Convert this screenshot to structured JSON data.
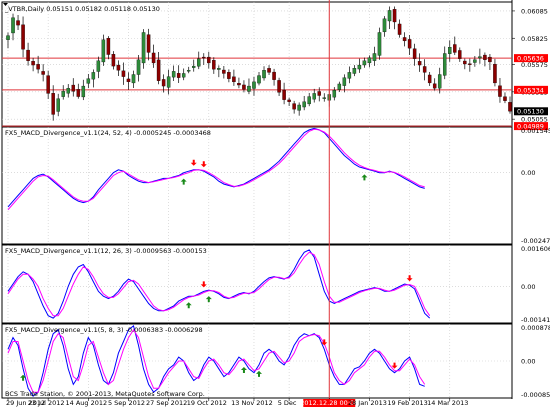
{
  "colors": {
    "background": "#ffffff",
    "grid": "#c8c8c8",
    "separator": "#000000",
    "bull_candle": "#2e8b3a",
    "bear_candle": "#8b0000",
    "wick": "#000000",
    "hline": "#e0343a",
    "vline": "#e0343a",
    "macd": "#0000ff",
    "signal": "#ff00ff",
    "up_arrow": "#1a8a1a",
    "down_arrow": "#ff0000",
    "price_pill": "#ff0000",
    "current_pill": "#000000"
  },
  "chart_data": [
    {
      "type": "candlestick",
      "title": "_VTBR,Daily  0.05151 0.05182 0.05118 0.05130",
      "y_axis_ticks": [
        "0.06085",
        "0.05825",
        "0.05575",
        "0.05315",
        "0.05055"
      ],
      "ylim": [
        0.0499,
        0.0617
      ],
      "price_levels": [
        {
          "label": "0.05636",
          "value": 0.05636
        },
        {
          "label": "0.05334",
          "value": 0.05334
        },
        {
          "label": "0.04989",
          "value": 0.04989
        }
      ],
      "current_price": {
        "label": "0.05130",
        "value": 0.0513
      },
      "close_series": [
        0.0585,
        0.0602,
        0.0595,
        0.0572,
        0.0561,
        0.0557,
        0.0553,
        0.0548,
        0.053,
        0.051,
        0.0525,
        0.0532,
        0.0535,
        0.0532,
        0.0527,
        0.0537,
        0.0544,
        0.055,
        0.0561,
        0.0581,
        0.0567,
        0.0556,
        0.0552,
        0.0546,
        0.0541,
        0.0548,
        0.0562,
        0.0588,
        0.0569,
        0.0559,
        0.0542,
        0.0537,
        0.0546,
        0.0551,
        0.0545,
        0.0549,
        0.0552,
        0.0556,
        0.0563,
        0.0564,
        0.0559,
        0.0553,
        0.0554,
        0.0549,
        0.0544,
        0.0541,
        0.0538,
        0.0534,
        0.0537,
        0.0541,
        0.0547,
        0.0552,
        0.055,
        0.0543,
        0.0531,
        0.0524,
        0.0522,
        0.0515,
        0.0519,
        0.0522,
        0.0527,
        0.053,
        0.0528,
        0.0526,
        0.0529,
        0.0533,
        0.0539,
        0.0545,
        0.055,
        0.0554,
        0.0557,
        0.0561,
        0.0564,
        0.0568,
        0.0588,
        0.0601,
        0.0609,
        0.0598,
        0.0586,
        0.058,
        0.0573,
        0.0563,
        0.0557,
        0.055,
        0.054,
        0.0535,
        0.0548,
        0.0568,
        0.0574,
        0.0569,
        0.0563,
        0.0558,
        0.0558,
        0.0562,
        0.0565,
        0.0562,
        0.056,
        0.054,
        0.0527,
        0.0523,
        0.0513
      ],
      "x_tick_labels": [
        "29 Jun 2012",
        "23 Jul 2012",
        "14 Aug 2012",
        "5 Sep 2012",
        "27 Sep 2012",
        "19 Oct 2012",
        "13 Nov 2012",
        "5 Dec",
        "2012.12.28 00:00",
        "28 Jan 2013",
        "19 Feb 2013",
        "14 Mar 2013"
      ],
      "x_tick_index": [
        0,
        8,
        16,
        24,
        32,
        40,
        49,
        56,
        64,
        72,
        80,
        88
      ],
      "cursor_index": 64,
      "cursor_label": "2012.12.28 00:00"
    },
    {
      "type": "line",
      "title": "FX5_MACD_Divergence_v1.1(24, 52, 4) -0.0005245 -0.0003468",
      "series": [
        {
          "name": "MACD",
          "values": [
            -0.0012,
            -0.001,
            -0.0008,
            -0.0006,
            -0.0004,
            -0.0002,
            -0.0001,
            -5e-05,
            -0.00015,
            -0.0003,
            -0.00045,
            -0.0006,
            -0.00075,
            -0.0009,
            -0.001,
            -0.00105,
            -0.001,
            -0.00085,
            -0.0006,
            -0.0004,
            -0.0002,
            0.0,
            0.0001,
            5e-05,
            -0.0001,
            -0.0002,
            -0.0003,
            -0.00035,
            -0.00035,
            -0.0003,
            -0.00025,
            -0.0002,
            -0.0002,
            -0.00015,
            -0.0001,
            0.0,
            5e-05,
            0.0001,
            0.0001,
            5e-05,
            -5e-05,
            -0.00015,
            -0.0003,
            -0.0004,
            -0.00045,
            -0.0005,
            -0.00045,
            -0.0004,
            -0.0003,
            -0.0002,
            -0.0001,
            0.0,
            0.0001,
            0.00025,
            0.0004,
            0.0006,
            0.0008,
            0.001,
            0.0012,
            0.0014,
            0.0015,
            0.00155,
            0.0015,
            0.0014,
            0.0012,
            0.001,
            0.0008,
            0.0006,
            0.00045,
            0.0003,
            0.0002,
            0.00015,
            0.0001,
            5e-05,
            0.0,
            0.0,
            5e-05,
            0.0,
            -0.0001,
            -0.0002,
            -0.0003,
            -0.0004,
            -0.0005,
            -0.00055
          ]
        },
        {
          "name": "Signal",
          "values": [
            -0.0013,
            -0.0011,
            -0.0009,
            -0.0007,
            -0.0005,
            -0.0003,
            -0.00015,
            -0.0001,
            -0.00012,
            -0.00025,
            -0.0004,
            -0.00055,
            -0.0007,
            -0.00085,
            -0.00095,
            -0.001,
            -0.001,
            -0.0009,
            -0.0007,
            -0.0005,
            -0.0003,
            -0.0001,
            0.0,
            5e-05,
            -5e-05,
            -0.00015,
            -0.00025,
            -0.0003,
            -0.00035,
            -0.00032,
            -0.00028,
            -0.00024,
            -0.0002,
            -0.00017,
            -0.00012,
            -5e-05,
            0.0,
            8e-05,
            0.0001,
            8e-05,
            0.0,
            -0.0001,
            -0.00022,
            -0.00035,
            -0.00042,
            -0.00048,
            -0.00047,
            -0.00042,
            -0.00035,
            -0.00025,
            -0.00015,
            -5e-05,
            5e-05,
            0.00018,
            0.00032,
            0.0005,
            0.0007,
            0.0009,
            0.0011,
            0.0013,
            0.00145,
            0.00152,
            0.0015,
            0.00142,
            0.00128,
            0.0011,
            0.0009,
            0.0007,
            0.00053,
            0.00038,
            0.00026,
            0.00018,
            0.00012,
            8e-05,
            3e-05,
            1e-05,
            3e-05,
            1e-05,
            -6e-05,
            -0.00015,
            -0.00025,
            -0.00035,
            -0.00045,
            -0.0005
          ]
        }
      ],
      "y_axis_ticks": [
        "0.001545",
        "0.00",
        "-0.002477"
      ],
      "ylim": [
        -0.0025,
        0.0016
      ],
      "arrows": [
        {
          "kind": "up",
          "index": 35
        },
        {
          "kind": "down",
          "index": 37
        },
        {
          "kind": "down",
          "index": 39
        },
        {
          "kind": "up",
          "index": 71
        }
      ]
    },
    {
      "type": "line",
      "title": "FX5_MACD_Divergence_v1.1(12, 26, 3) -0.0009563 -0.000153",
      "series": [
        {
          "name": "MACD",
          "values": [
            -0.0002,
            0.0001,
            0.0004,
            0.0006,
            0.0005,
            0.0002,
            -0.0003,
            -0.0008,
            -0.0012,
            -0.0013,
            -0.0011,
            -0.0006,
            0.0,
            0.0005,
            0.0008,
            0.0009,
            0.0006,
            0.0002,
            -0.0002,
            -0.0004,
            -0.0005,
            -0.0004,
            -0.0002,
            0.0001,
            0.0003,
            0.0002,
            -0.0001,
            -0.0004,
            -0.0007,
            -0.0009,
            -0.001,
            -0.001,
            -0.0009,
            -0.0008,
            -0.0006,
            -0.0005,
            -0.0004,
            -0.0004,
            -0.0003,
            -0.0002,
            -0.00015,
            -0.0002,
            -0.0003,
            -0.00045,
            -0.0005,
            -0.0004,
            -0.0003,
            -0.00025,
            -0.0003,
            -0.0002,
            0.0,
            0.0002,
            0.00035,
            0.0004,
            0.00035,
            0.0003,
            0.0004,
            0.0007,
            0.0011,
            0.0014,
            0.0015,
            0.0012,
            0.0005,
            -0.0002,
            -0.0006,
            -0.0007,
            -0.0006,
            -0.0005,
            -0.0004,
            -0.0003,
            -0.0002,
            -0.00015,
            -0.0001,
            -5e-05,
            -0.0001,
            -0.0002,
            -0.0002,
            -0.0001,
            0.0,
            0.0001,
            5e-05,
            -0.0001,
            -0.0006,
            -0.0011,
            -0.0013
          ]
        },
        {
          "name": "Signal",
          "values": [
            -0.0003,
            0.0,
            0.0003,
            0.0005,
            0.0005,
            0.0003,
            0.0,
            -0.0005,
            -0.0009,
            -0.0012,
            -0.0012,
            -0.0009,
            -0.0004,
            0.0001,
            0.0005,
            0.0008,
            0.0007,
            0.0004,
            0.0,
            -0.0003,
            -0.00045,
            -0.00045,
            -0.0003,
            -5e-05,
            0.0002,
            0.00025,
            0.0001,
            -0.0002,
            -0.0005,
            -0.0008,
            -0.00095,
            -0.001,
            -0.00095,
            -0.00085,
            -0.0007,
            -0.00055,
            -0.00045,
            -0.0004,
            -0.00035,
            -0.00025,
            -0.00018,
            -0.00018,
            -0.00025,
            -0.0004,
            -0.00048,
            -0.00045,
            -0.00035,
            -0.00028,
            -0.00028,
            -0.00025,
            -0.0001,
            0.0001,
            0.00028,
            0.00038,
            0.00038,
            0.00032,
            0.00035,
            0.00055,
            0.0009,
            0.0012,
            0.0014,
            0.0013,
            0.0009,
            0.0002,
            -0.0004,
            -0.00065,
            -0.00065,
            -0.00055,
            -0.00045,
            -0.00035,
            -0.00025,
            -0.00018,
            -0.00012,
            -8e-05,
            -8e-05,
            -0.00015,
            -0.0002,
            -0.00015,
            -5e-05,
            5e-05,
            8e-05,
            0.0,
            -0.0004,
            -0.0009,
            -0.0012
          ]
        }
      ],
      "y_axis_ticks": [
        "0.001606",
        "0.00",
        "-0.001412"
      ],
      "ylim": [
        -0.0015,
        0.0017
      ],
      "arrows": [
        {
          "kind": "up",
          "index": 36
        },
        {
          "kind": "down",
          "index": 39
        },
        {
          "kind": "up",
          "index": 40
        },
        {
          "kind": "down",
          "index": 80
        }
      ]
    },
    {
      "type": "line",
      "title": "FX5_MACD_Divergence_v1.1(5, 8, 3) -0.0006383 -0.0006298",
      "series": [
        {
          "name": "MACD",
          "values": [
            0.0003,
            0.0006,
            0.0004,
            -0.0002,
            -0.0007,
            -0.0009,
            -0.0008,
            -0.0003,
            0.0003,
            0.0007,
            0.0008,
            0.0004,
            -0.0002,
            -0.0006,
            -0.0004,
            0.0002,
            0.0006,
            0.0004,
            -0.0001,
            -0.0005,
            -0.0006,
            -0.0003,
            0.0002,
            0.0005,
            0.0008,
            0.0009,
            0.0004,
            -0.0002,
            -0.0006,
            -0.0008,
            -0.0007,
            -0.0004,
            -0.0002,
            -0.0001,
            0.0001,
            0.0,
            -0.0003,
            -0.0005,
            -0.0004,
            -0.0001,
            0.0001,
            0.0,
            -0.0002,
            -0.0004,
            -0.0003,
            -0.0001,
            0.0001,
            0.0,
            -0.0002,
            -0.0003,
            -0.0001,
            0.0002,
            0.0003,
            0.0002,
            0.0,
            -0.0001,
            0.0001,
            0.0004,
            0.0006,
            0.0007,
            0.00065,
            0.0007,
            0.0006,
            0.0003,
            -0.0001,
            -0.0004,
            -0.0006,
            -0.0006,
            -0.0004,
            -0.0002,
            -0.00015,
            0.0,
            0.0002,
            0.0003,
            0.0002,
            0.0,
            -0.0002,
            -0.0003,
            -0.0002,
            0.0,
            0.0001,
            -0.0002,
            -0.0006,
            -0.00065
          ]
        },
        {
          "name": "Signal",
          "values": [
            0.0002,
            0.0005,
            0.0005,
            0.0,
            -0.0005,
            -0.0008,
            -0.0008,
            -0.0005,
            0.0,
            0.0005,
            0.0007,
            0.0006,
            0.0001,
            -0.0004,
            -0.0005,
            -0.0001,
            0.0004,
            0.0005,
            0.0001,
            -0.0003,
            -0.0006,
            -0.0005,
            -0.0001,
            0.0003,
            0.0006,
            0.0008,
            0.0006,
            0.0001,
            -0.0004,
            -0.0007,
            -0.0007,
            -0.0005,
            -0.0003,
            -0.00015,
            0.0,
            0.0,
            -0.0002,
            -0.0004,
            -0.00045,
            -0.0002,
            0.0,
            5e-05,
            -0.0001,
            -0.0003,
            -0.00035,
            -0.0002,
            0.0,
            5e-05,
            -0.0001,
            -0.00025,
            -0.0002,
            0.0,
            0.0002,
            0.00025,
            0.0001,
            -5e-05,
            0.0,
            0.0002,
            0.0005,
            0.0006,
            0.00065,
            0.00068,
            0.00065,
            0.00045,
            0.0001,
            -0.0003,
            -0.0005,
            -0.0006,
            -0.0005,
            -0.0003,
            -0.0002,
            -0.0001,
            0.0001,
            0.00025,
            0.00025,
            0.0001,
            -0.0001,
            -0.00025,
            -0.00025,
            -0.0001,
            5e-05,
            -0.0001,
            -0.0004,
            -0.0006
          ]
        }
      ],
      "y_axis_ticks": [
        "0.000878",
        "0.00",
        "-0.000856"
      ],
      "ylim": [
        -0.00095,
        0.00095
      ],
      "arrows": [
        {
          "kind": "up",
          "index": 3
        },
        {
          "kind": "up",
          "index": 47
        },
        {
          "kind": "up",
          "index": 50
        },
        {
          "kind": "down",
          "index": 63
        },
        {
          "kind": "down",
          "index": 77
        }
      ]
    }
  ],
  "footer": {
    "copyright": "BCS Trade Station, © 2001-2013, MetaQuotes Software Corp."
  }
}
